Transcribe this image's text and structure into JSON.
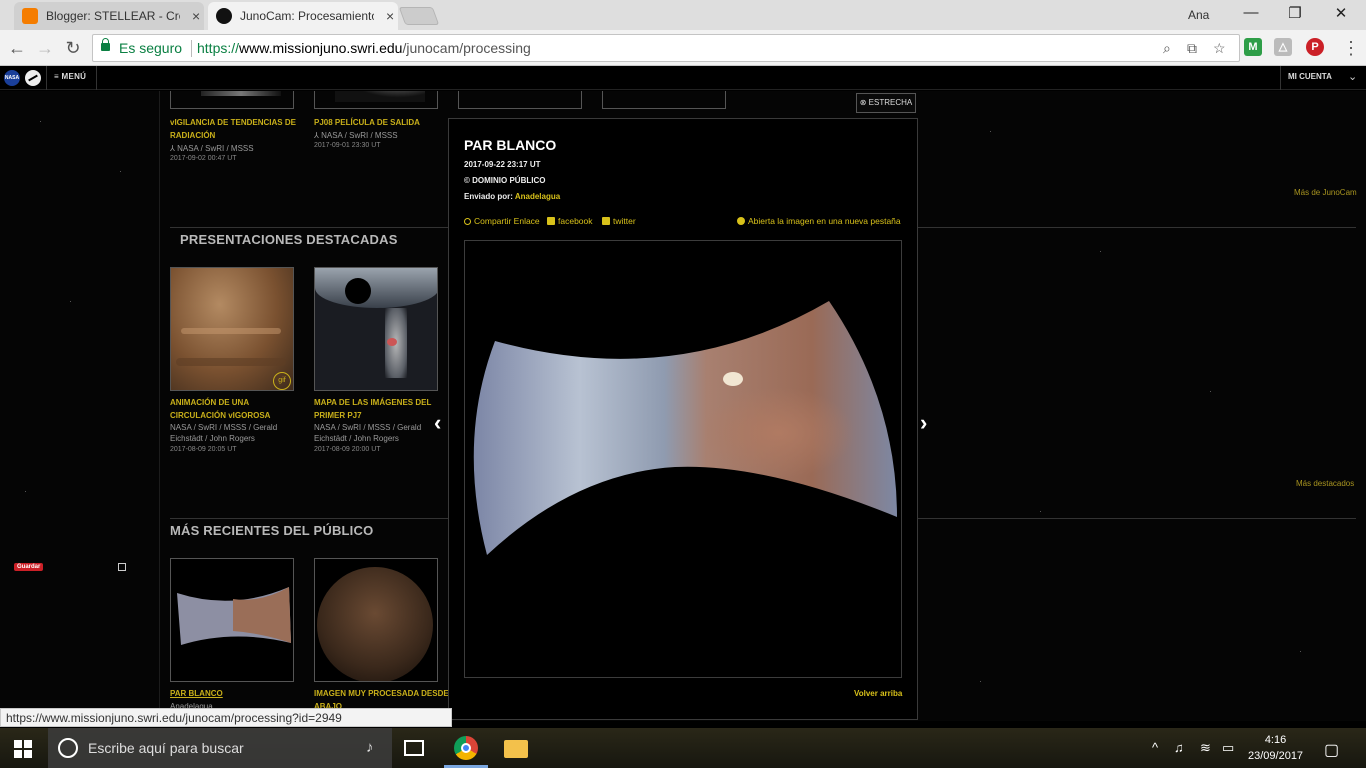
{
  "browser": {
    "tabs": [
      {
        "title": "Blogger: STELLEAR - Cre",
        "close": "×"
      },
      {
        "title": "JunoCam: Procesamiento",
        "close": "×"
      }
    ],
    "profile": "Ana",
    "window_controls": {
      "minimize": "—",
      "maximize": "❐",
      "close": "✕"
    },
    "secure_label": "Es seguro",
    "url_scheme": "https://",
    "url_host": "www.missionjuno.swri.edu",
    "url_path": "/junocam/processing",
    "status_url": "https://www.missionjuno.swri.edu/junocam/processing?id=2949"
  },
  "site_header": {
    "nasa_logo": "NASA",
    "menu": "≡ MENÚ",
    "account": "MI CUENTA",
    "account_chevron": "⌄"
  },
  "top_row": [
    {
      "title_line1": "vIGILANCIA DE TENDENCIAS DE",
      "title_line2": "RADIACIÓN",
      "credit": "⅄ NASA / SwRI / MSSS",
      "date": "2017-09-02 00:47 UT"
    },
    {
      "title_line1": "PJ08 PELÍCULA DE SALIDA",
      "title_line2": "",
      "credit": "⅄ NASA / SwRI / MSSS",
      "date": "2017-09-01 23:30 UT"
    }
  ],
  "more_junocam": "Más de JunoCam",
  "featured": {
    "title": "PRESENTACIONES DESTACADAS",
    "more": "Más destacados",
    "gif_badge": "gif",
    "items": [
      {
        "title_line1": "ANIMACIÓN DE UNA",
        "title_line2": "CIRCULACIÓN vIGOROSA",
        "credit_line1": "NASA / SwRI / MSSS / Gerald",
        "credit_line2": "Eichstädt / John Rogers",
        "date": "2017-08-09 20:05 UT"
      },
      {
        "title_line1": "MAPA DE LAS IMÁGENES DEL",
        "title_line2": "PRIMER PJ7",
        "credit_line1": "NASA / SwRI / MSSS / Gerald",
        "credit_line2": "Eichstädt / John Rogers",
        "date": "2017-08-09 20:00 UT"
      }
    ]
  },
  "public_recent": {
    "title": "MÁS RECIENTES DEL PÚBLICO",
    "items": [
      {
        "title_line1": "PAR BLANCO",
        "title_line2": "",
        "credit": "Anadelagua"
      },
      {
        "title_line1": "IMAGEN MUY PROCESADA DESDE",
        "title_line2": "ABAJO",
        "credit": ""
      }
    ]
  },
  "pin_save": "Guardar",
  "modal": {
    "close": "⊗ ESTRECHA",
    "title": "PAR BLANCO",
    "date": "2017-09-22 23:17 UT",
    "license": "© DOMINIO PÚBLICO",
    "sent_by_label": "Enviado por: ",
    "sent_by_user": "Anadelagua",
    "share_link": "Compartir Enlace",
    "facebook": "facebook",
    "twitter": "twitter",
    "open_new_tab": "Abierta la imagen en una nueva pestaña",
    "prev": "‹",
    "next": "›",
    "back_to_top": "Volver arriba"
  },
  "taskbar": {
    "search_placeholder": "Escribe aquí para buscar",
    "time": "4:16",
    "date": "23/09/2017"
  },
  "colors": {
    "accent_yellow": "#d8c11a",
    "secure_green": "#0b8043",
    "page_bg": "#050505"
  }
}
